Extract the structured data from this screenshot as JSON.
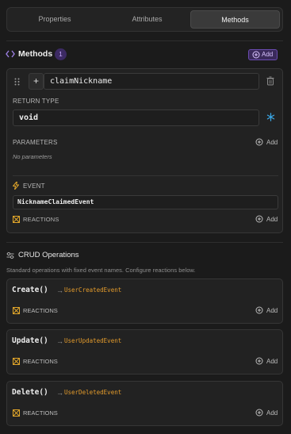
{
  "tabs": [
    {
      "label": "Properties"
    },
    {
      "label": "Attributes"
    },
    {
      "label": "Methods"
    }
  ],
  "methods_section": {
    "title": "Methods",
    "count": "1",
    "add_label": "Add"
  },
  "method": {
    "name": "claimNickname",
    "return_type_label": "RETURN TYPE",
    "return_type": "void",
    "parameters_label": "PARAMETERS",
    "parameters_add": "Add",
    "no_parameters": "No parameters",
    "event_label": "EVENT",
    "event_name": "NicknameClaimedEvent",
    "reactions_label": "REACTIONS",
    "reactions_add": "Add"
  },
  "crud": {
    "title": "CRUD Operations",
    "description": "Standard operations with fixed event names. Configure reactions below.",
    "operations": [
      {
        "name": "Create()",
        "event": "UserCreatedEvent",
        "reactions_label": "REACTIONS",
        "add": "Add"
      },
      {
        "name": "Update()",
        "event": "UserUpdatedEvent",
        "reactions_label": "REACTIONS",
        "add": "Add"
      },
      {
        "name": "Delete()",
        "event": "UserDeletedEvent",
        "reactions_label": "REACTIONS",
        "add": "Add"
      }
    ]
  },
  "colors": {
    "accent_purple": "#7c5cc4",
    "event_orange": "#e39b2c",
    "reactions_yellow": "#e0a52a",
    "snow_blue": "#3aa8e8"
  }
}
